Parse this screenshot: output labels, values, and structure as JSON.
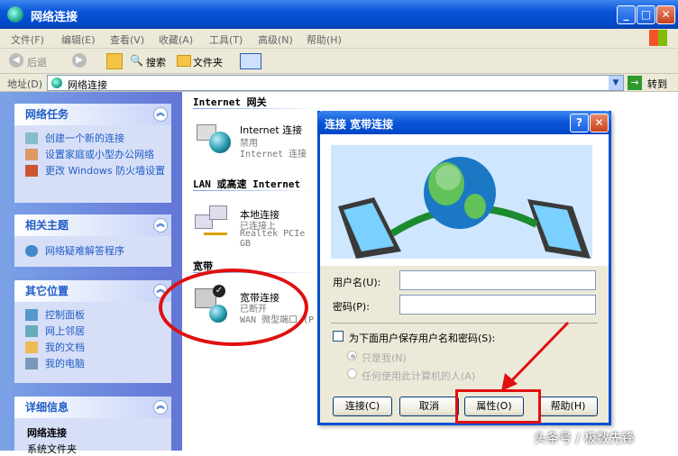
{
  "window": {
    "title": "网络连接"
  },
  "menu": [
    "文件(F)",
    "编辑(E)",
    "查看(V)",
    "收藏(A)",
    "工具(T)",
    "高级(N)",
    "帮助(H)"
  ],
  "toolbar": {
    "back": "后退",
    "search": "搜索",
    "folders": "文件夹"
  },
  "address": {
    "label": "地址(D)",
    "value": "网络连接",
    "go": "转到"
  },
  "sidebar": {
    "network_tasks": {
      "title": "网络任务",
      "items": [
        "创建一个新的连接",
        "设置家庭或小型办公网络",
        "更改 Windows 防火墙设置"
      ]
    },
    "related": {
      "title": "相关主题",
      "items": [
        "网络疑难解答程序"
      ]
    },
    "other_places": {
      "title": "其它位置",
      "items": [
        "控制面板",
        "网上邻居",
        "我的文档",
        "我的电脑"
      ]
    },
    "details": {
      "title": "详细信息",
      "name": "网络连接",
      "type": "系统文件夹"
    }
  },
  "main": {
    "groups": [
      "Internet 网关",
      "LAN 或高速 Internet",
      "宽带"
    ],
    "conn1": {
      "name": "Internet 连接",
      "status": "禁用",
      "device": "Internet 连接"
    },
    "conn2": {
      "name": "本地连接",
      "status": "已连接上",
      "device": "Realtek PCIe GB"
    },
    "conn3": {
      "name": "宽带连接",
      "status": "已断开",
      "device": "WAN 微型端口 (P"
    }
  },
  "dialog": {
    "title": "连接 宽带连接",
    "username_label": "用户名(U):",
    "password_label": "密码(P):",
    "save_label": "为下面用户保存用户名和密码(S):",
    "only_me": "只是我(N)",
    "anyone": "任何使用此计算机的人(A)",
    "btn_connect": "连接(C)",
    "btn_cancel": "取消",
    "btn_properties": "属性(O)",
    "btn_help": "帮助(H)"
  },
  "watermark": "头条号 / 极数先锋",
  "colors": {
    "xp_blue": "#0a55d8",
    "annotation_red": "#e01010"
  }
}
